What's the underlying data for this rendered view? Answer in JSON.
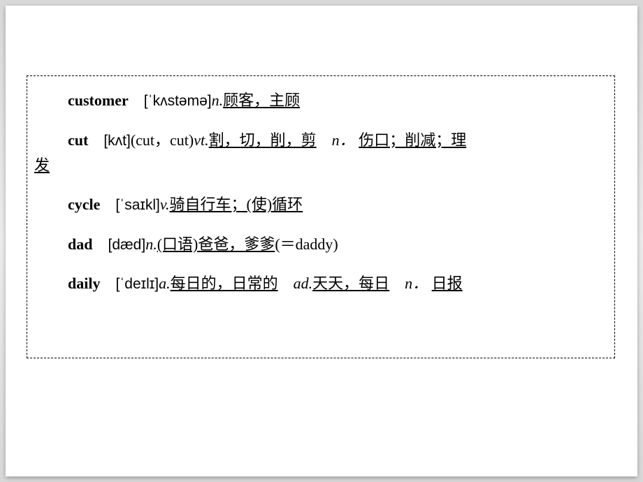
{
  "entries": {
    "customer": {
      "word": "customer",
      "ipa": "[ˈkʌstəmə]",
      "pos1": "n.",
      "def1": "顾客，主顾"
    },
    "cut": {
      "word": "cut",
      "ipa": "[kʌt]",
      "forms": "(cut，cut)",
      "pos1": "vt.",
      "def1": "割，切，削，剪",
      "pos2": "n．",
      "def2a": "伤口；削减；理",
      "def2b": "发"
    },
    "cycle": {
      "word": "cycle",
      "ipa": "[ˈsaɪkl]",
      "pos1": "v.",
      "def1": "骑自行车；(使)循环"
    },
    "dad": {
      "word": "dad",
      "ipa": "[dæd]",
      "pos1": "n.",
      "def1": "(口语)爸爸，爹爹",
      "note": "(＝daddy)"
    },
    "daily": {
      "word": "daily",
      "ipa": "[ˈdeɪlɪ]",
      "pos1": "a.",
      "def1": "每日的，日常的",
      "pos2": "ad.",
      "def2": "天天，每日",
      "pos3": "n．",
      "def3": "日报"
    }
  }
}
